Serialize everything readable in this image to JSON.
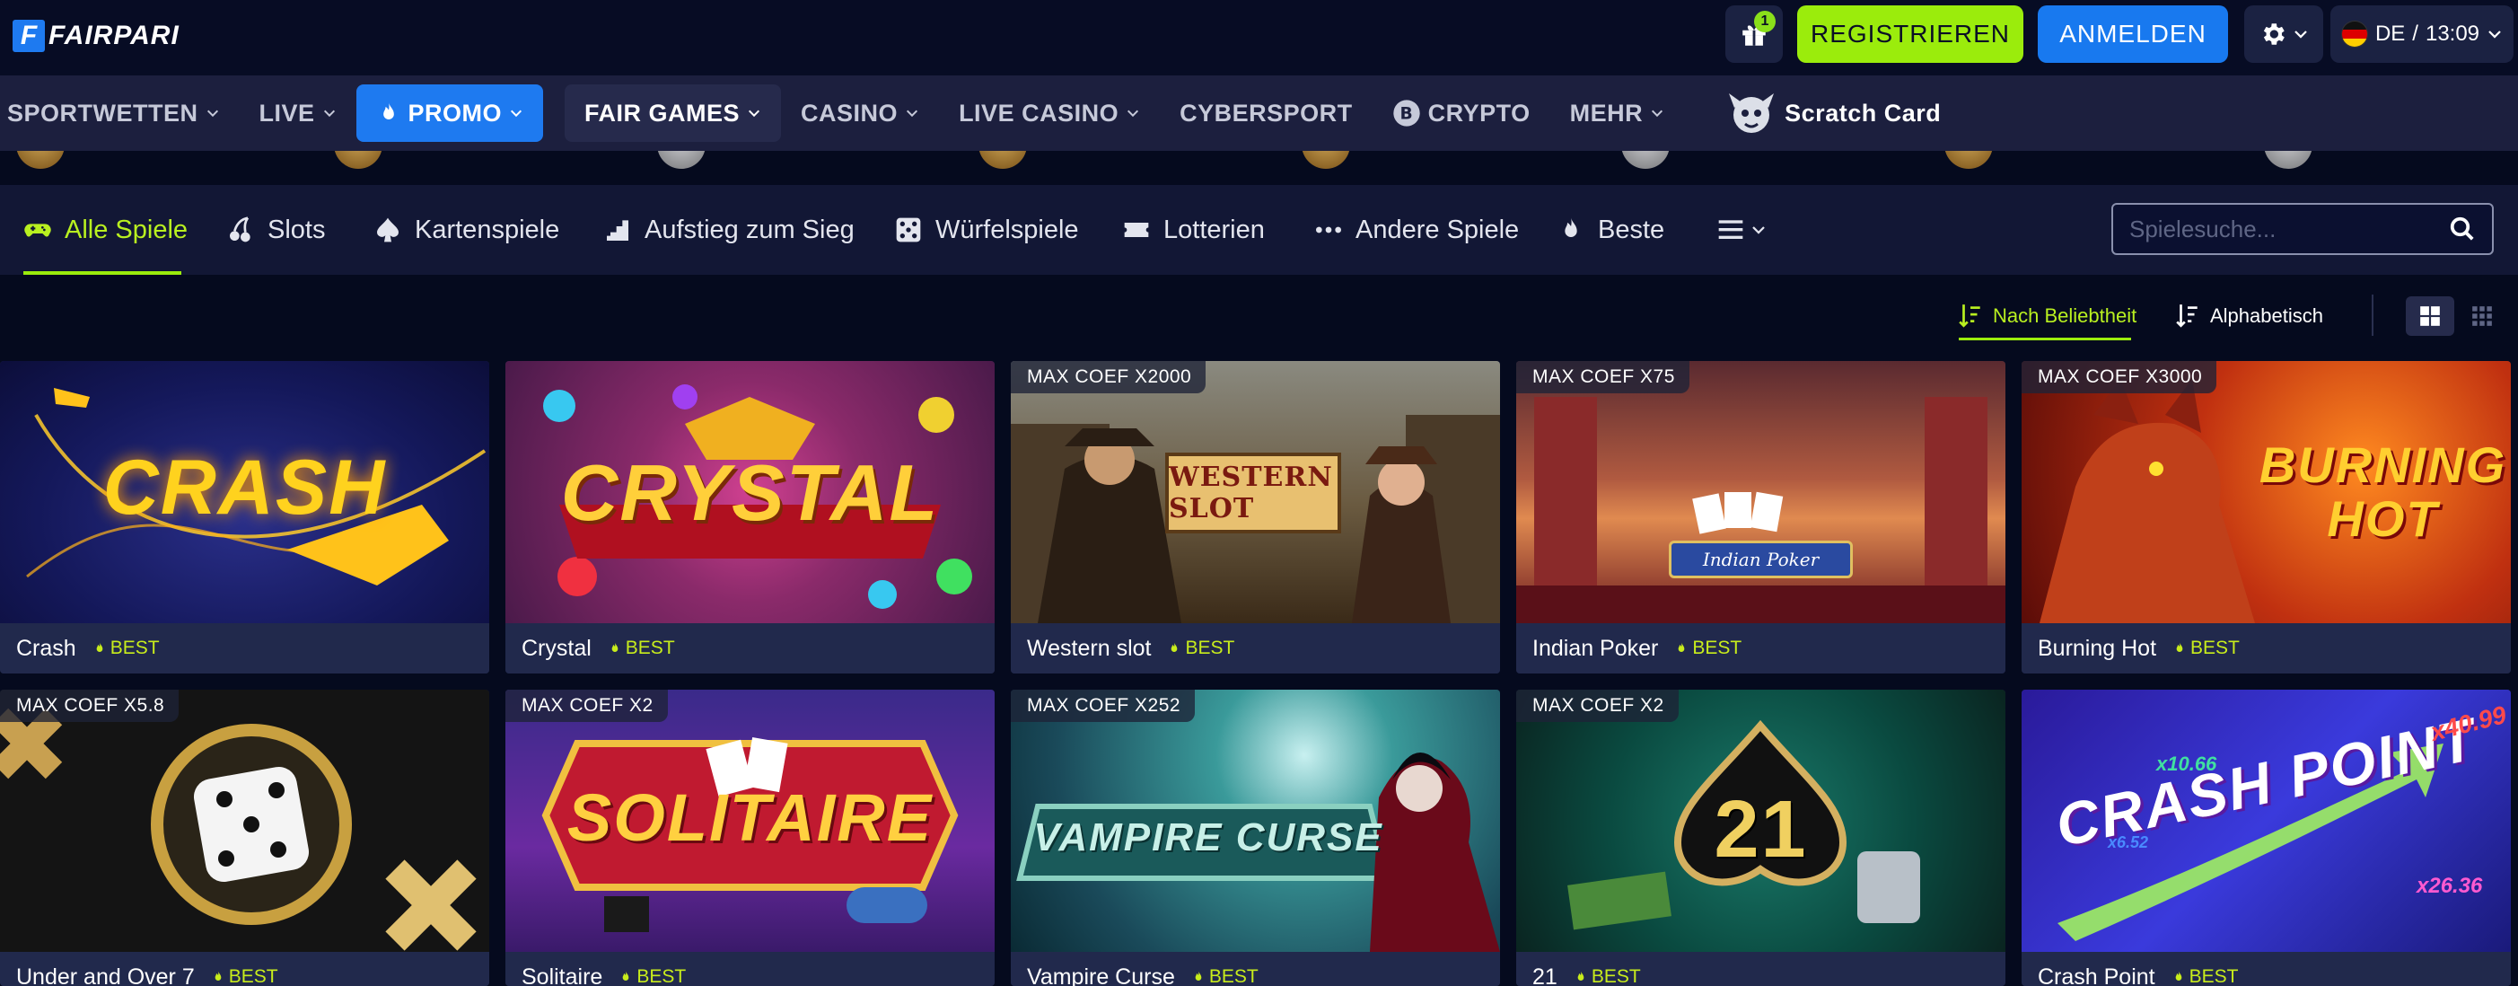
{
  "brand": {
    "name": "FAIRPARI",
    "mark": "F"
  },
  "topbar": {
    "gift_count": "1",
    "register_label": "REGISTRIEREN",
    "login_label": "ANMELDEN",
    "lang": "DE",
    "separator": "/",
    "time": "13:09"
  },
  "nav": {
    "items": [
      {
        "label": "SPORTWETTEN"
      },
      {
        "label": "LIVE"
      },
      {
        "label": "PROMO"
      },
      {
        "label": "FAIR GAMES"
      },
      {
        "label": "CASINO"
      },
      {
        "label": "LIVE CASINO"
      },
      {
        "label": "CYBERSPORT"
      },
      {
        "label": "CRYPTO"
      },
      {
        "label": "MEHR"
      },
      {
        "label": "Scratch Card"
      }
    ]
  },
  "categories": [
    {
      "label": "Alle Spiele",
      "icon": "gamepad-icon",
      "active": true
    },
    {
      "label": "Slots",
      "icon": "cherries-icon"
    },
    {
      "label": "Kartenspiele",
      "icon": "spade-icon"
    },
    {
      "label": "Aufstieg zum Sieg",
      "icon": "steps-icon"
    },
    {
      "label": "Würfelspiele",
      "icon": "dice-icon"
    },
    {
      "label": "Lotterien",
      "icon": "ticket-icon"
    },
    {
      "label": "Andere Spiele",
      "icon": "dots-icon"
    },
    {
      "label": "Beste",
      "icon": "flame-icon"
    }
  ],
  "search": {
    "placeholder": "Spielesuche..."
  },
  "sort": {
    "popularity": "Nach Beliebtheit",
    "alphabetical": "Alphabetisch"
  },
  "colors": {
    "accent_green": "#9bec0c",
    "accent_blue": "#1879ef",
    "bg": "#050a1e",
    "nav_bg": "#1c1f3e"
  },
  "games": [
    {
      "name": "Crash",
      "badge": "BEST",
      "coef": "",
      "art_title": "CRASH"
    },
    {
      "name": "Crystal",
      "badge": "BEST",
      "coef": "",
      "art_title": "CRYSTAL"
    },
    {
      "name": "Western slot",
      "badge": "BEST",
      "coef": "MAX COEF X2000",
      "art_title": "WESTERN SLOT"
    },
    {
      "name": "Indian Poker",
      "badge": "BEST",
      "coef": "MAX COEF X75",
      "art_title": "Indian Poker"
    },
    {
      "name": "Burning Hot",
      "badge": "BEST",
      "coef": "MAX COEF X3000",
      "art_title": "BURNING HOT"
    },
    {
      "name": "Under and Over 7",
      "badge": "BEST",
      "coef": "MAX COEF X5.8",
      "art_title": ""
    },
    {
      "name": "Solitaire",
      "badge": "BEST",
      "coef": "MAX COEF X2",
      "art_title": "SOLITAIRE"
    },
    {
      "name": "Vampire Curse",
      "badge": "BEST",
      "coef": "MAX COEF X252",
      "art_title": "VAMPIRE CURSE"
    },
    {
      "name": "21",
      "badge": "BEST",
      "coef": "MAX COEF X2",
      "art_title": "21"
    },
    {
      "name": "Crash Point",
      "badge": "BEST",
      "coef": "",
      "art_title": "CRASH POINT"
    }
  ],
  "art_numbers": {
    "crash_point_a": "x10.66",
    "crash_point_b": "x40.99",
    "crash_point_c": "x26.36",
    "crash_point_d": "x6.52"
  }
}
